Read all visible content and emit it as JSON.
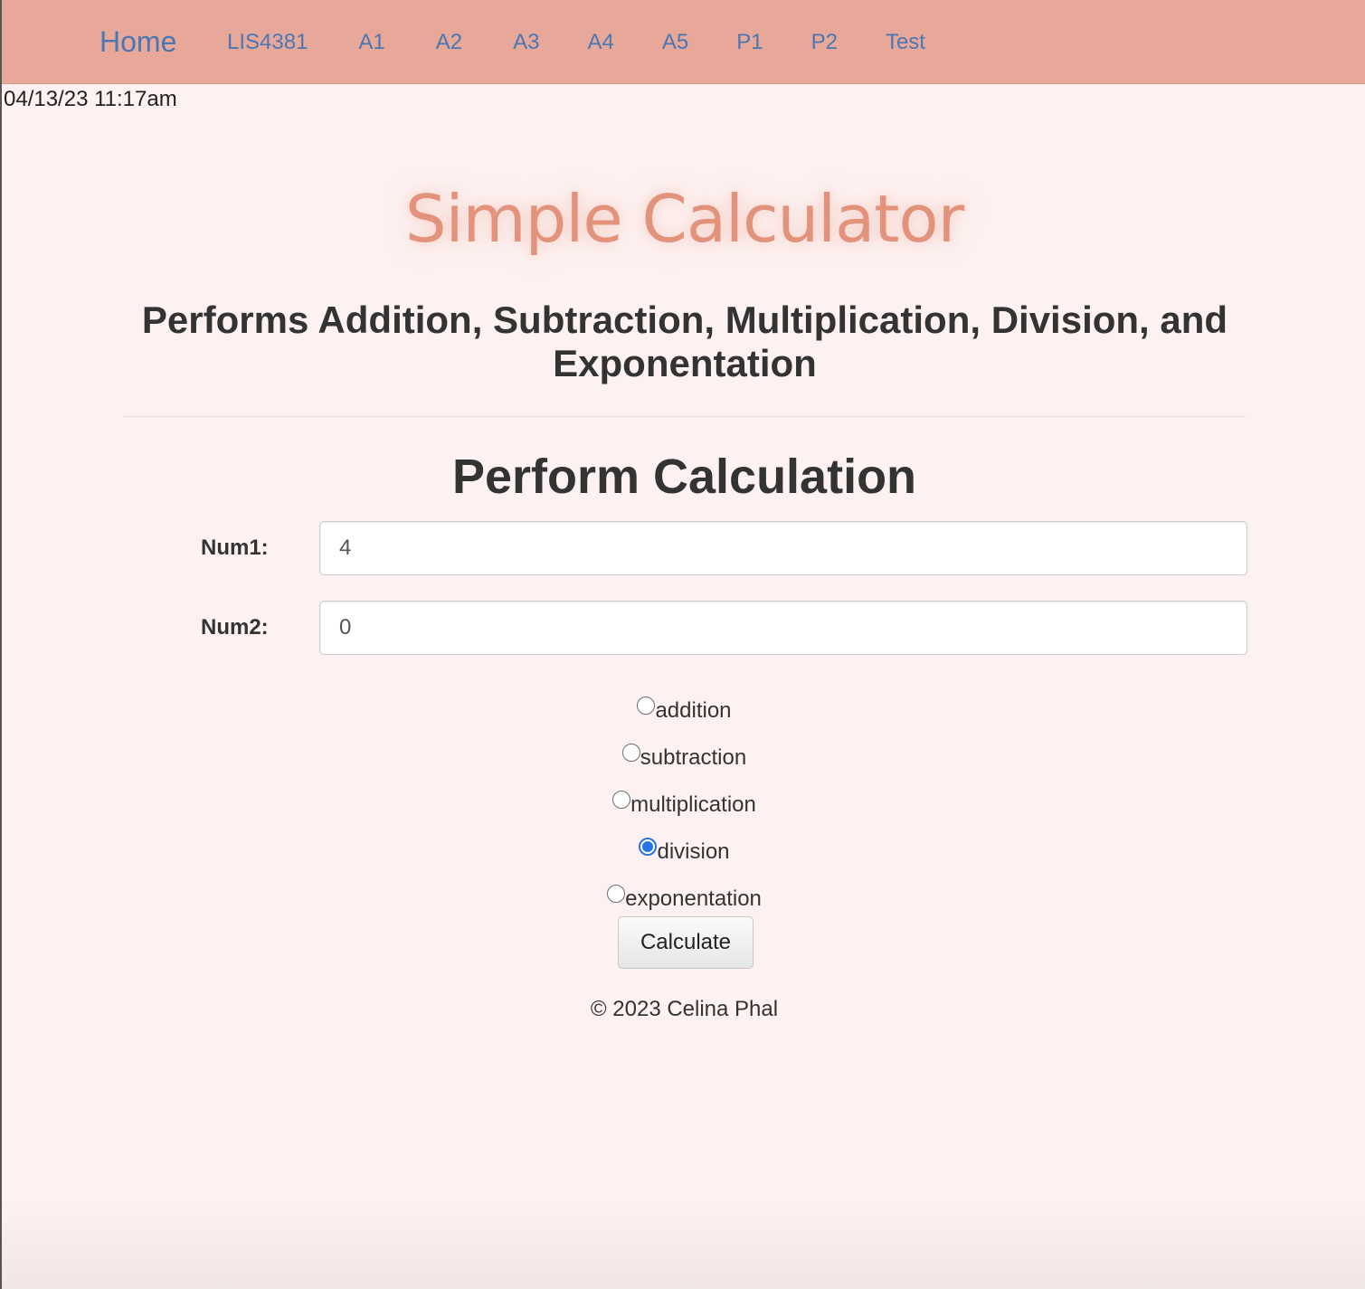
{
  "nav": {
    "brand": "Home",
    "links": [
      "LIS4381",
      "A1",
      "A2",
      "A3",
      "A4",
      "A5",
      "P1",
      "P2",
      "Test"
    ]
  },
  "timestamp": "04/13/23 11:17am",
  "title": "Simple Calculator",
  "subtitle": "Performs Addition, Subtraction, Multiplication, Division, and Exponentation",
  "form": {
    "heading": "Perform Calculation",
    "num1_label": "Num1:",
    "num1_value": "4",
    "num2_label": "Num2:",
    "num2_value": "0",
    "operations": [
      {
        "label": "addition",
        "checked": false
      },
      {
        "label": "subtraction",
        "checked": false
      },
      {
        "label": "multiplication",
        "checked": false
      },
      {
        "label": "division",
        "checked": true
      },
      {
        "label": "exponentation",
        "checked": false
      }
    ],
    "button_label": "Calculate"
  },
  "footer": "© 2023 Celina Phal",
  "colors": {
    "navbar": "#e8a899",
    "link": "#4a77b4",
    "title": "#e3927c",
    "background": "#fdf2f1",
    "radio_selected": "#2b74e3"
  }
}
